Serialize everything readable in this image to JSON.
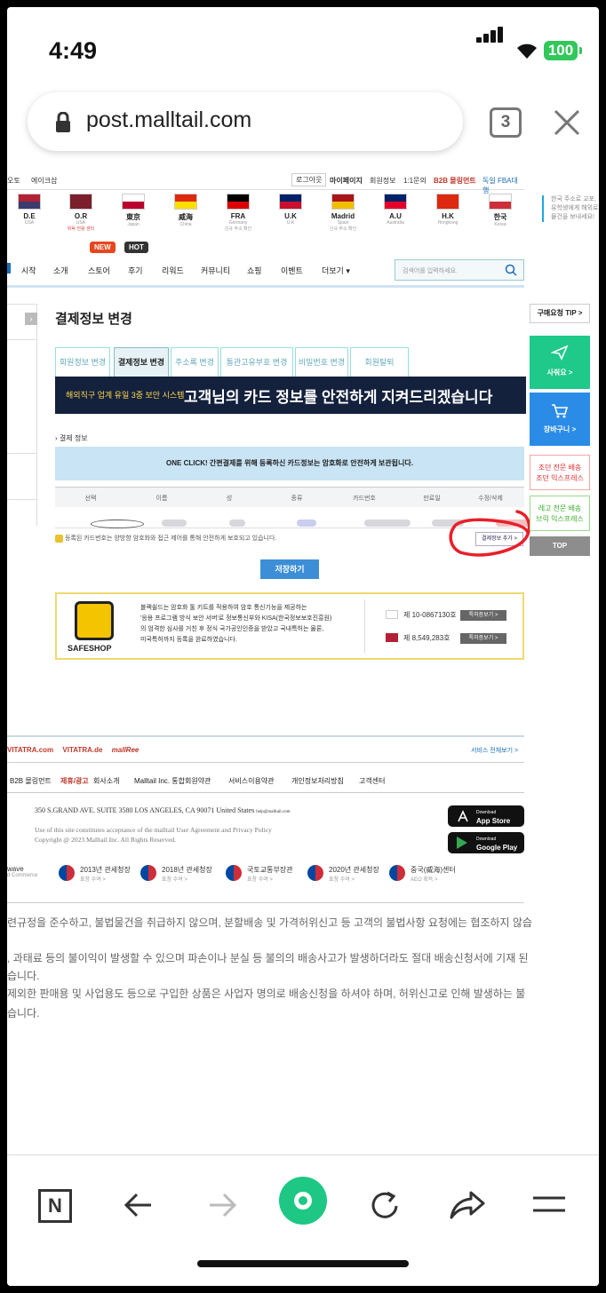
{
  "status": {
    "time": "4:49",
    "battery": "100"
  },
  "browser": {
    "url": "post.malltail.com",
    "tab_count": "3"
  },
  "topbar": {
    "left": [
      "오토",
      "에이크삽"
    ],
    "right": [
      "로그아웃",
      "마이페이지",
      "회원정보",
      "1:1문의",
      "B2B 몰링먼트",
      "독일 FBA대행"
    ]
  },
  "flags": [
    {
      "name": "D.E",
      "sub": "USA",
      "c1": "#b22234",
      "c2": "#3c3b6e"
    },
    {
      "name": "O.R",
      "sub": "USA",
      "note": "위탁 전용 센터",
      "c1": "#7a1f2b",
      "c2": "#7a1f2b"
    },
    {
      "name": "東京",
      "sub": "Japan",
      "c1": "#ffffff",
      "c2": "#bc002d"
    },
    {
      "name": "威海",
      "sub": "China",
      "c1": "#de2910",
      "c2": "#ffde00"
    },
    {
      "name": "FRA",
      "sub": "Germany",
      "note": "신규 주소 확인",
      "c1": "#000000",
      "c2": "#dd0000"
    },
    {
      "name": "U.K",
      "sub": "U.K",
      "c1": "#012169",
      "c2": "#c8102e"
    },
    {
      "name": "Madrid",
      "sub": "Spain",
      "note": "신규 주소 확인",
      "c1": "#aa151b",
      "c2": "#f1bf00"
    },
    {
      "name": "A.U",
      "sub": "Australia",
      "c1": "#012169",
      "c2": "#e4002b"
    },
    {
      "name": "H.K",
      "sub": "Hongkong",
      "c1": "#de2910",
      "c2": "#de2910"
    },
    {
      "name": "한국",
      "sub": "Korea",
      "c1": "#ffffff",
      "c2": "#cd2e3a"
    }
  ],
  "side_notice": "한국 주소로 교포,유학생에게 해외로 물건을 보내세요!",
  "nav": {
    "items": [
      "시작",
      "소개",
      "스토어",
      "후기",
      "리워드",
      "커뮤니티",
      "쇼핑",
      "이벤트",
      "더보기"
    ],
    "new_badge": "NEW",
    "hot_badge": "HOT",
    "search_placeholder": "검색어를 입력하세요."
  },
  "page": {
    "title": "결제정보 변경",
    "tabs": [
      "회원정보 변경",
      "결제정보 변경",
      "주소록 변경",
      "통관고유부호 변경",
      "비밀번호 변경",
      "회원탈퇴"
    ],
    "active_tab": 1
  },
  "banner": {
    "small": "해외직구 업계 유일 3중 보안 시스템",
    "big": "고객님의 카드 정보를 안전하게 지켜드리겠습니다"
  },
  "payment": {
    "section": "결제 정보",
    "info": "ONE CLICK! 간편결제를 위해 등록하신 카드정보는 암호화로 안전하게 보관됩니다.",
    "columns": [
      "선택",
      "이름",
      "성",
      "종류",
      "카드번호",
      "만료일",
      "수정/삭제"
    ],
    "security_note": "등록된 카드번호는 양방향 암호화와 접근 제어를 통해 안전하게 보호되고 있습니다.",
    "add_button": "결제정보 추가 >",
    "save_button": "저장하기"
  },
  "safeshop": {
    "logo": "SAFESHOP",
    "lines": [
      "블랙쉴드는 암호화 툴 키트를 적용하여 암호 통신기능을 제공하는",
      "'응용 프로그램 방식 보안 서버'로 정보통신부와 KISA(한국정보보호진흥원)",
      "의 엄격한 심사를 거친 후 정식 국가공인인증을 받았고 국내특허는 물론,",
      "미국특허까지 등록을 완료하였습니다."
    ],
    "patent_kr": "제 10-0867130호",
    "patent_us": "제 8,549,283호",
    "patent_btn": "특허증보기 >"
  },
  "right_rail": {
    "tip": "구매요청 TIP >",
    "buy": "사줘요 >",
    "cart": "장바구니 >",
    "b1": [
      "조던 전문 배송",
      "조던 익스프레스"
    ],
    "b2": [
      "레고 전문 배송",
      "브릭 익스프레스"
    ],
    "top": "TOP"
  },
  "footer": {
    "brands": [
      "VITATRA.com",
      "VITATRA.de",
      "mallRee"
    ],
    "service_all": "서비스 전체보기 >",
    "links": [
      "B2B 몰링먼트",
      "제휴/광고",
      "회사소개",
      "Malltail Inc. 통합회원약관",
      "서비스이용약관",
      "개인정보처리방침",
      "고객센터"
    ],
    "address": "350 S.GRAND AVE. SUITE 3580 LOS ANGELES, CA 90071 United States",
    "email": "help@malltail.com",
    "legal1": "Use of this site constitutes acceptance of the malltail User Agreement and Privacy Policy",
    "legal2": "Copyright @ 2023 Malltail Inc. All Rights Reserved.",
    "app_store": "App Store",
    "google_play": "Google Play",
    "download": "Download",
    "wave": [
      "wave",
      "d Commerce"
    ],
    "awards": [
      {
        "t": "2013년 관세청장",
        "s": "표창 수여 >"
      },
      {
        "t": "2018년 관세청장",
        "s": "표창 수여 >"
      },
      {
        "t": "국토교통부장관",
        "s": "표창 수여 >"
      },
      {
        "t": "2020년 관세청장",
        "s": "표창 수여 >"
      },
      {
        "t": "중국(威海)센터",
        "s": "AEO 획득 >"
      }
    ]
  },
  "notices": [
    "련규정을 준수하고, 불법물건을 취급하지 않으며, 분할배송 및 가격허위신고 등 고객의 불법사항 요청에는 협조하지 않습",
    ", 과태료 등의 불이익이 발생할 수 있으며 파손이나 분실 등 불의의 배송사고가 발생하더라도 절대 배송신청서에 기재 된",
    "습니다.",
    "제외한 판매용 및 사업용도 등으로 구입한 상품은 사업자 명의로 배송신청을 하셔야 하며, 허위신고로 인해 발생하는 불",
    "습니다."
  ]
}
